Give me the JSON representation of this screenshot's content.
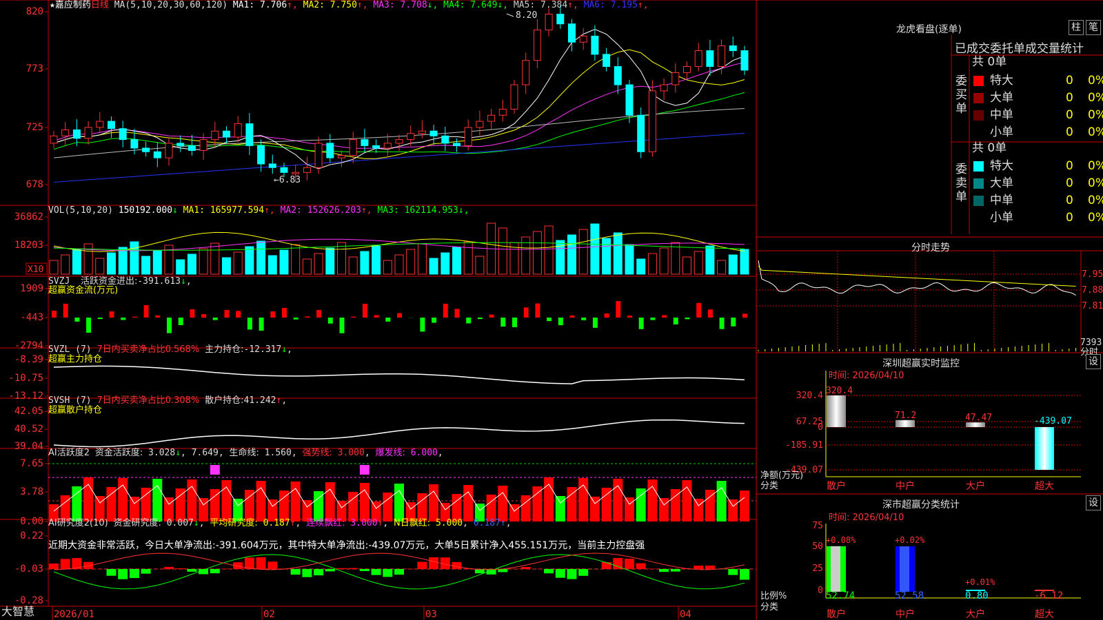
{
  "stock": {
    "title": "嘉应制药",
    "period": "日线",
    "ma_label": "MA(5,10,20,30,60,120)",
    "ma": [
      {
        "k": "MA1:",
        "v": "7.706",
        "arrow": "↑",
        "color": "#ffffff"
      },
      {
        "k": "MA2:",
        "v": "7.750",
        "arrow": "↑",
        "color": "#ffff00"
      },
      {
        "k": "MA3:",
        "v": "7.708",
        "arrow": "↓",
        "color": "#ff33ff"
      },
      {
        "k": "MA4:",
        "v": "7.649",
        "arrow": "↓",
        "color": "#00ff00"
      },
      {
        "k": "MA5:",
        "v": "7.384",
        "arrow": "↑",
        "color": "#cccccc"
      },
      {
        "k": "MA6:",
        "v": "7.195",
        "arrow": "↑",
        "color": "#3333ff"
      }
    ],
    "high_label": "8.20",
    "low_label": "6.83",
    "yticks": [
      "820",
      "773",
      "725",
      "678"
    ],
    "x_labels": [
      "2026/01",
      "02",
      "03",
      "04"
    ]
  },
  "vol": {
    "label": "VOL(5,10,20)",
    "value": "150192.000",
    "arrow": "↓",
    "ma": [
      {
        "k": "MA1:",
        "v": "165977.594",
        "arrow": "↑",
        "color": "#ffff00"
      },
      {
        "k": "MA2:",
        "v": "152626.203",
        "arrow": "↑",
        "color": "#ff33ff"
      },
      {
        "k": "MA3:",
        "v": "162114.953",
        "arrow": "↓",
        "color": "#00ff00"
      }
    ],
    "yticks": [
      "36862",
      "18203"
    ],
    "unit": "X10"
  },
  "svzj": {
    "label": "SVZJ",
    "desc": "活跃资金进出:",
    "value": "-391.613",
    "arrow": "↓",
    "sub": "超赢资金流(万元)",
    "yticks": [
      "1909",
      "-443",
      "-2794"
    ]
  },
  "svzl": {
    "label": "SVZL (7)",
    "t1": "7日内买卖净占比0.568%",
    "t2": "主力持仓:",
    "value": "-12.317",
    "arrow": "↓",
    "sub": "超赢主力持仓",
    "yticks": [
      "-8.39",
      "-10.75",
      "-13.12"
    ]
  },
  "svsh": {
    "label": "SVSH (7)",
    "t1": "7日内买卖净占比0.308%",
    "t2": "散户持仓:",
    "value": "41.242",
    "arrow": "↑",
    "sub": "超赢散户持仓",
    "yticks": [
      "42.05",
      "40.52",
      "39.04"
    ]
  },
  "ai_active": {
    "label": "AI活跃度2",
    "t1": "资金活跃度:",
    "v1": "3.028",
    "v2": "7.649",
    "t3": "生命线:",
    "v3": "1.560",
    "t4": "强势线:",
    "v4": "3.000",
    "t5": "爆发线:",
    "v5": "6.000",
    "yticks": [
      "7.65",
      "3.78",
      "0.00"
    ]
  },
  "ai_research": {
    "label": "AI研究度2(10)",
    "t1": "资金研究度:",
    "v1": "0.007",
    "t2": "平均研究度:",
    "v2": "0.187",
    "t3": "连续飘红:",
    "v3": "3.000",
    "t4": "N日飘红:",
    "v4": "5.000",
    "v5": "0.187",
    "summary": "近期大资金非常活跃，今日大单净流出:-391.604万元，其中特大单净流出:-439.07万元，大单5日累计净入455.151万元，当前主力控盘强",
    "yticks": [
      "0.22",
      "-0.03",
      "-0.28"
    ]
  },
  "footer": {
    "logo": "大智慧"
  },
  "dragon": {
    "title": "龙虎看盘(逐单)",
    "btn1": "柱",
    "btn2": "笔",
    "tabs": "已成交委托单成交量统计",
    "buy_side": "委买单",
    "sell_side": "委卖单",
    "buy_total": "共 0单",
    "sell_total": "共 0单",
    "buy_rows": [
      {
        "name": "特大",
        "n": "0",
        "p": "0%",
        "color": "#ff0000"
      },
      {
        "name": "大单",
        "n": "0",
        "p": "0%",
        "color": "#990000"
      },
      {
        "name": "中单",
        "n": "0",
        "p": "0%",
        "color": "#660000"
      },
      {
        "name": "小单",
        "n": "0",
        "p": "0%",
        "color": "#000000"
      }
    ],
    "sell_rows": [
      {
        "name": "特大",
        "n": "0",
        "p": "0%",
        "color": "#00ffff"
      },
      {
        "name": "大单",
        "n": "0",
        "p": "0%",
        "color": "#008888"
      },
      {
        "name": "中单",
        "n": "0",
        "p": "0%",
        "color": "#006666"
      },
      {
        "name": "小单",
        "n": "0",
        "p": "0%",
        "color": "#000000"
      }
    ]
  },
  "intraday": {
    "title": "分时走势",
    "yticks": [
      "7.95",
      "7.88",
      "7.81"
    ],
    "vol_label": "7393",
    "bottom_label": "分时"
  },
  "sz_monitor": {
    "title": "深圳超赢实时监控",
    "btn": "设",
    "time": "时间: 2026/04/10",
    "yticks": [
      "320.4",
      "67.25",
      "0",
      "-185.91",
      "-439.07"
    ],
    "ylabel": "净额(万元)",
    "xlabel": "分类",
    "cats": [
      "散户",
      "中户",
      "大户",
      "超大"
    ],
    "values": [
      320.4,
      71.2,
      47.47,
      -439.07
    ],
    "value_labels": [
      "320.4",
      "71.2",
      "47.47",
      "-439.07"
    ]
  },
  "sz_class": {
    "title": "深市超赢分类统计",
    "btn": "设",
    "time": "时间: 2026/04/10",
    "yticks": [
      "75",
      "50",
      "25",
      "0"
    ],
    "ylabel": "比例%",
    "xlabel": "分类",
    "cats": [
      "散户",
      "中户",
      "大户",
      "超大"
    ],
    "values": [
      52.74,
      52.58,
      0.8,
      -6.12
    ],
    "value_labels": [
      "52.74",
      "52.58",
      "0.80",
      "-6.12"
    ],
    "top_labels": [
      "+0.08%",
      "+0.02%",
      "+0.01%",
      ""
    ]
  }
}
